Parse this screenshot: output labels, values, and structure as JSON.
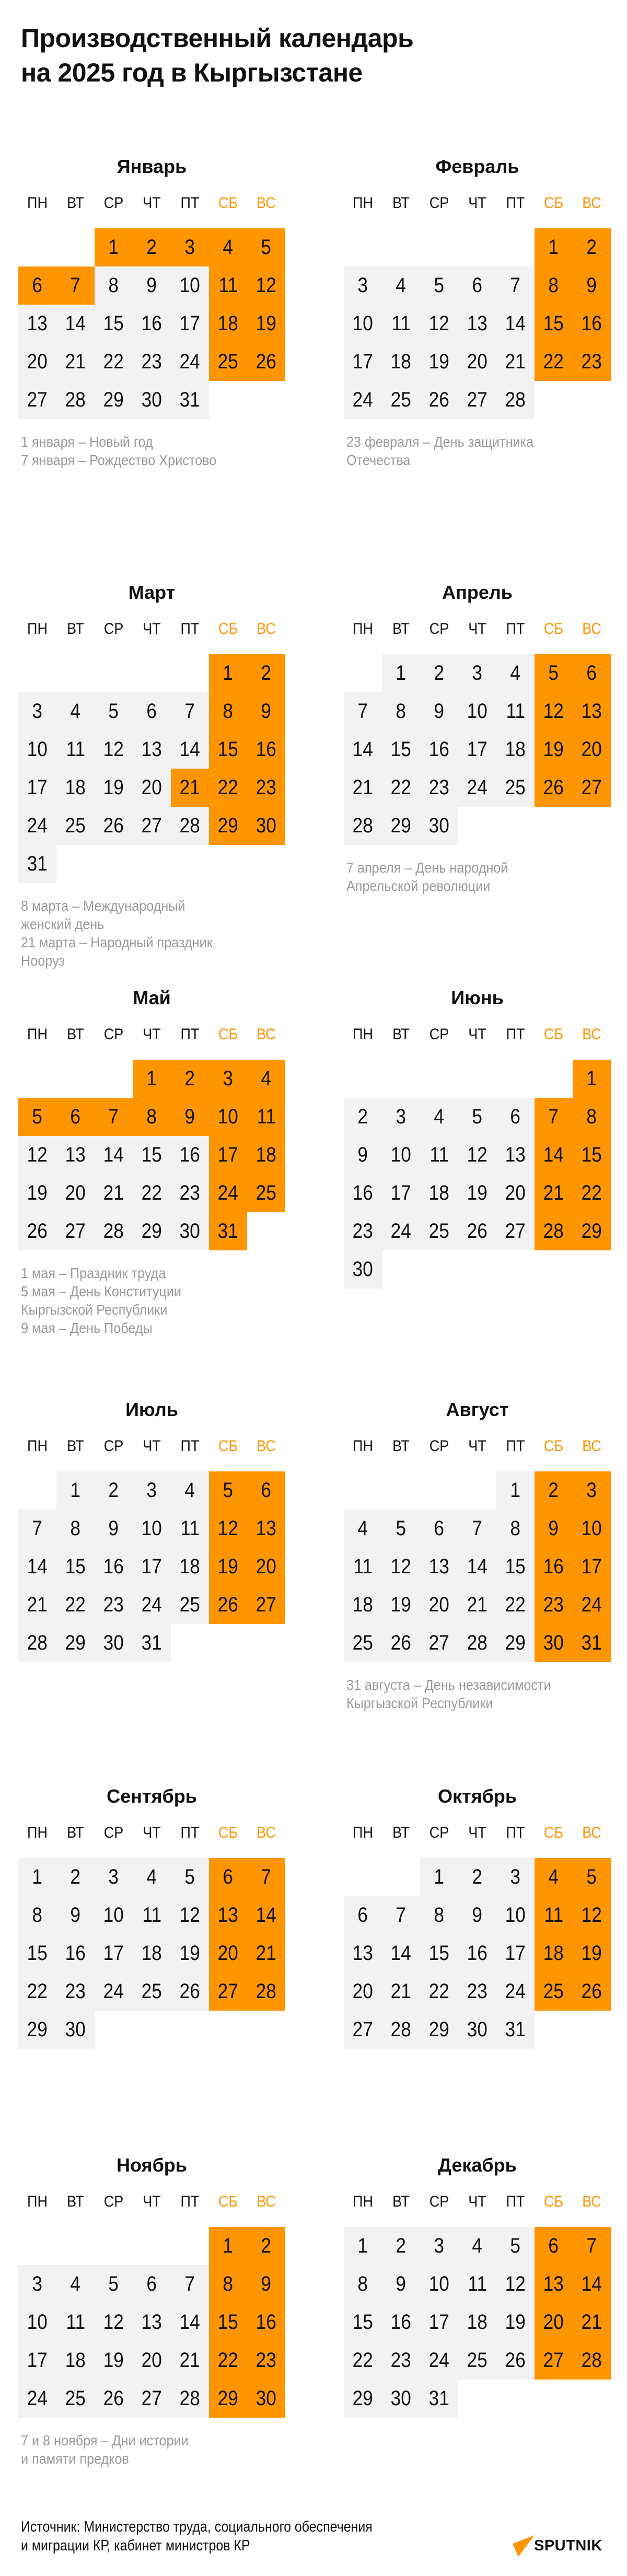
{
  "title": [
    "Производственный календарь",
    "на 2025 год в Кыргызстане"
  ],
  "colors": {
    "day_off": "#FF9500",
    "workday": "#F2F2F2",
    "weekend_label": "#FF9500",
    "note_text": "#9a9a9a"
  },
  "weekdays": [
    "ПН",
    "ВТ",
    "СР",
    "ЧТ",
    "ПТ",
    "СБ",
    "ВС"
  ],
  "months": [
    {
      "name": "Январь",
      "first_weekday": 3,
      "days": 31,
      "holidays": [
        1,
        2,
        3,
        6,
        7
      ],
      "notes": [
        "1 января – Новый год",
        "7 января – Рождество Христово"
      ]
    },
    {
      "name": "Февраль",
      "first_weekday": 6,
      "days": 28,
      "holidays": [],
      "notes": [
        "23 февраля – День защитника",
        "Отечества"
      ]
    },
    {
      "name": "Март",
      "first_weekday": 6,
      "days": 31,
      "holidays": [
        21
      ],
      "notes": [
        "8 марта – Международный",
        "женский день",
        "21 марта – Народный праздник",
        "Нооруз"
      ]
    },
    {
      "name": "Апрель",
      "first_weekday": 2,
      "days": 30,
      "holidays": [],
      "notes": [
        "7 апреля – День народной",
        "Апрельской революции"
      ]
    },
    {
      "name": "Май",
      "first_weekday": 4,
      "days": 31,
      "holidays": [
        1,
        2,
        5,
        6,
        7,
        8,
        9
      ],
      "notes": [
        "1 мая – Праздник труда",
        "5 мая – День Конституции",
        "Кыргызской Республики",
        "9 мая – День Победы"
      ]
    },
    {
      "name": "Июнь",
      "first_weekday": 7,
      "days": 30,
      "holidays": [],
      "notes": []
    },
    {
      "name": "Июль",
      "first_weekday": 2,
      "days": 31,
      "holidays": [],
      "notes": []
    },
    {
      "name": "Август",
      "first_weekday": 5,
      "days": 31,
      "holidays": [],
      "notes": [
        "31 августа – День независимости",
        "Кыргызской Республики"
      ]
    },
    {
      "name": "Сентябрь",
      "first_weekday": 1,
      "days": 30,
      "holidays": [],
      "notes": []
    },
    {
      "name": "Октябрь",
      "first_weekday": 3,
      "days": 31,
      "holidays": [],
      "notes": []
    },
    {
      "name": "Ноябрь",
      "first_weekday": 6,
      "days": 30,
      "holidays": [],
      "notes": [
        "7 и 8 ноября – Дни истории",
        "и памяти предков"
      ]
    },
    {
      "name": "Декабрь",
      "first_weekday": 1,
      "days": 31,
      "holidays": [],
      "notes": []
    }
  ],
  "source": [
    "Источник: Министерство труда, социального обеспечения",
    "и миграции КР, кабинет министров КР"
  ],
  "logo": {
    "text": "SPUTNIK",
    "icon": "sputnik-logo-icon"
  }
}
